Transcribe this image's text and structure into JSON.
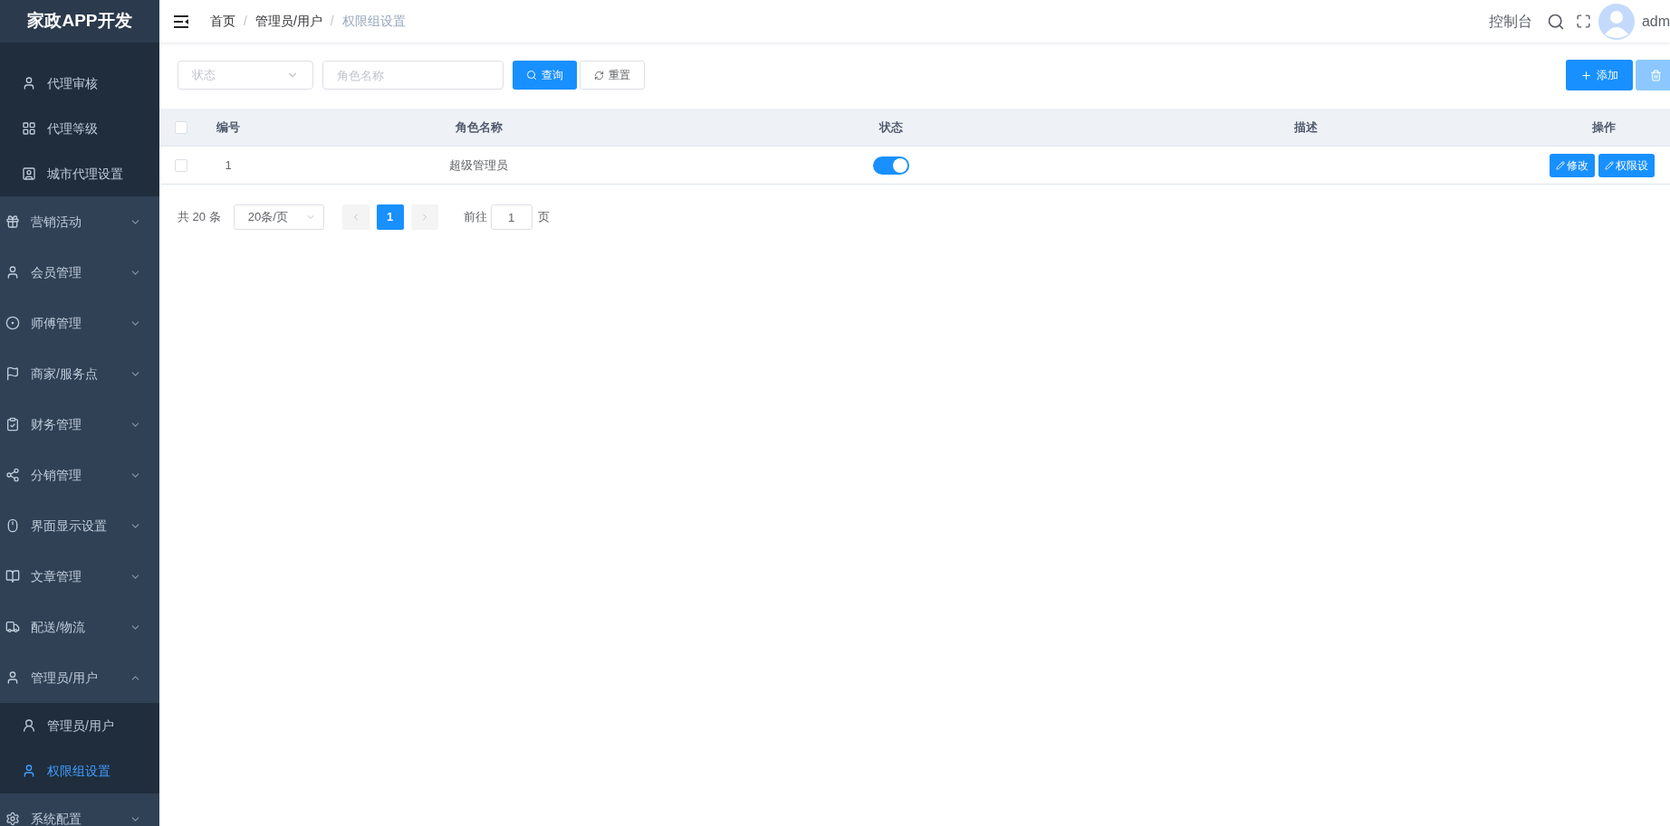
{
  "sidebar": {
    "logo": "家政APP开发",
    "top_children": [
      {
        "label": "代理审核",
        "selected": false
      },
      {
        "label": "代理等级",
        "selected": false
      },
      {
        "label": "城市代理设置",
        "selected": false
      }
    ],
    "items": [
      {
        "label": "营销活动",
        "expanded": false
      },
      {
        "label": "会员管理",
        "expanded": false
      },
      {
        "label": "师傅管理",
        "expanded": false
      },
      {
        "label": "商家/服务点",
        "expanded": false
      },
      {
        "label": "财务管理",
        "expanded": false
      },
      {
        "label": "分销管理",
        "expanded": false
      },
      {
        "label": "界面显示设置",
        "expanded": false
      },
      {
        "label": "文章管理",
        "expanded": false
      },
      {
        "label": "配送/物流",
        "expanded": false
      },
      {
        "label": "管理员/用户",
        "expanded": true,
        "children": [
          {
            "label": "管理员/用户",
            "selected": false
          },
          {
            "label": "权限组设置",
            "selected": true
          }
        ]
      },
      {
        "label": "系统配置",
        "expanded": false
      }
    ]
  },
  "header": {
    "breadcrumbs": [
      {
        "label": "首页"
      },
      {
        "separator": "/",
        "label": "管理员/用户"
      },
      {
        "separator": "/",
        "label": "权限组设置"
      }
    ],
    "console": "控制台",
    "user": "adm"
  },
  "filters": {
    "status": {
      "placeholder": "状态"
    },
    "role_name": {
      "placeholder": "角色名称"
    },
    "search_button": "查询",
    "reset_button": "重置"
  },
  "actions": {
    "add_button": "添加",
    "delete_button": {
      "disabled": true
    }
  },
  "table": {
    "all_checked": false,
    "columns": [
      "编号",
      "角色名称",
      "状态",
      "描述",
      "操作"
    ],
    "rows": [
      {
        "checked": false,
        "id": "1",
        "role": "超级管理员",
        "status_on": true,
        "buttons": [
          "修改",
          "权限设"
        ]
      }
    ]
  },
  "pagination": {
    "total": "共 20 条",
    "page_size": "20条/页",
    "pages": [
      {
        "label": "1",
        "selected": true
      }
    ],
    "goto_label": "前往",
    "goto_value": "1",
    "page_suffix": "页"
  }
}
